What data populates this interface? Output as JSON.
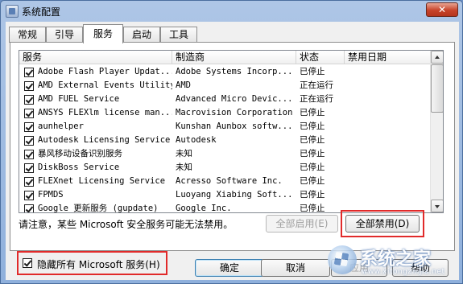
{
  "window": {
    "title": "系统配置",
    "close_label": "✕"
  },
  "tabs": [
    {
      "label": "常规"
    },
    {
      "label": "引导"
    },
    {
      "label": "服务"
    },
    {
      "label": "启动"
    },
    {
      "label": "工具"
    }
  ],
  "list": {
    "headers": [
      "服务",
      "制造商",
      "状态",
      "禁用日期"
    ],
    "rows": [
      {
        "service": "Adobe Flash Player Updat...",
        "vendor": "Adobe Systems Incorp...",
        "status": "已停止",
        "disabled_date": ""
      },
      {
        "service": "AMD External Events Utility",
        "vendor": "AMD",
        "status": "正在运行",
        "disabled_date": ""
      },
      {
        "service": "AMD FUEL Service",
        "vendor": "Advanced Micro Devic...",
        "status": "正在运行",
        "disabled_date": ""
      },
      {
        "service": "ANSYS FLEXlm license man...",
        "vendor": "Macrovision Corporation",
        "status": "已停止",
        "disabled_date": ""
      },
      {
        "service": "aunhelper",
        "vendor": "Kunshan Aunbox softw...",
        "status": "已停止",
        "disabled_date": ""
      },
      {
        "service": "Autodesk Licensing Service",
        "vendor": "Autodesk",
        "status": "已停止",
        "disabled_date": ""
      },
      {
        "service": "暴风移动设备识别服务",
        "vendor": "未知",
        "status": "已停止",
        "disabled_date": ""
      },
      {
        "service": "DiskBoss Service",
        "vendor": "未知",
        "status": "已停止",
        "disabled_date": ""
      },
      {
        "service": "FLEXnet Licensing Service",
        "vendor": "Acresso Software Inc.",
        "status": "已停止",
        "disabled_date": ""
      },
      {
        "service": "FPMDS",
        "vendor": "Luoyang Xiabing Soft...",
        "status": "已停止",
        "disabled_date": ""
      },
      {
        "service": "Google 更新服务 (gupdate)",
        "vendor": "Google Inc.",
        "status": "已停止",
        "disabled_date": ""
      }
    ]
  },
  "notice": "请注意，某些 Microsoft 安全服务可能无法禁用。",
  "buttons": {
    "enable_all": "全部启用(E)",
    "disable_all": "全部禁用(D)",
    "ok": "确定",
    "cancel": "取消",
    "apply": "应用",
    "help": "帮助"
  },
  "hide_ms": {
    "label": "隐藏所有 Microsoft 服务(H)",
    "checked": true
  },
  "watermark": {
    "text": "系统之家",
    "url": "www.xitongzhijia.net"
  },
  "colors": {
    "highlight_border": "#e12a2a",
    "titlebar": "#aec6e6"
  }
}
